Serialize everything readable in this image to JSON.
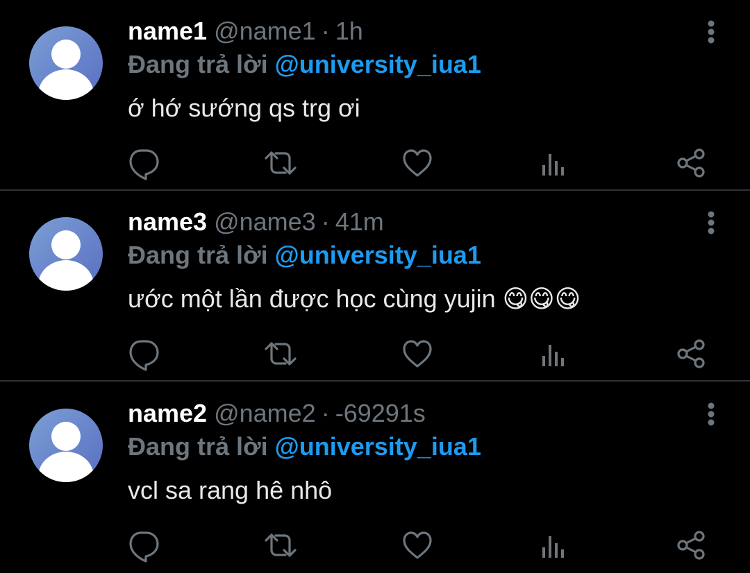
{
  "theme": {
    "background": "#000000",
    "divider": "#2f3336",
    "text_primary": "#e7e9ea",
    "text_secondary": "#6e767d",
    "accent": "#1d9bf0"
  },
  "tweets": [
    {
      "display_name": "name1",
      "handle": "@name1",
      "separator": "·",
      "time": "1h",
      "reply_prefix": "Đang trả lời",
      "reply_to": "@university_iua1",
      "text": "ớ hớ sướng qs trg ơi",
      "avatar_icon": "default-profile-icon",
      "actions": [
        "reply-icon",
        "retweet-icon",
        "like-icon",
        "views-icon",
        "share-icon"
      ]
    },
    {
      "display_name": "name3",
      "handle": "@name3",
      "separator": "·",
      "time": "41m",
      "reply_prefix": "Đang trả lời",
      "reply_to": "@university_iua1",
      "text": "ước một lần được học cùng yujin 😋😋😋",
      "avatar_icon": "default-profile-icon",
      "actions": [
        "reply-icon",
        "retweet-icon",
        "like-icon",
        "views-icon",
        "share-icon"
      ]
    },
    {
      "display_name": "name2",
      "handle": "@name2",
      "separator": "·",
      "time": "-69291s",
      "reply_prefix": "Đang trả lời",
      "reply_to": "@university_iua1",
      "text": "vcl sa rang hê nhô",
      "avatar_icon": "default-profile-icon",
      "actions": [
        "reply-icon",
        "retweet-icon",
        "like-icon",
        "views-icon",
        "share-icon"
      ]
    }
  ]
}
